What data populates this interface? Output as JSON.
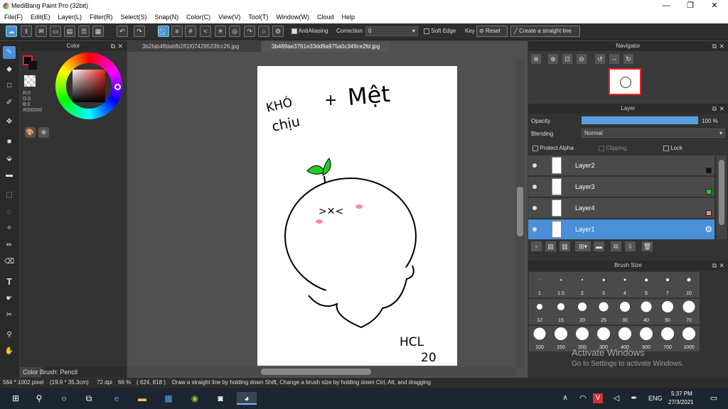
{
  "titlebar": {
    "title": "MediBang Paint Pro (32bit)",
    "minimize": "—",
    "maximize": "❐",
    "close": "✕"
  },
  "menu": [
    "File(F)",
    "Edit(E)",
    "Layer(L)",
    "Filter(R)",
    "Select(S)",
    "Snap(N)",
    "Color(C)",
    "View(V)",
    "Tool(T)",
    "Window(W)",
    "Cloud",
    "Help"
  ],
  "toolbar": {
    "antialiasing": "AntiAliasing",
    "correction_label": "Correction",
    "correction_value": "0",
    "soft_edge": "Soft Edge",
    "key": "Key",
    "reset": "Reset",
    "straight_line": "Create a straight line"
  },
  "color_panel": {
    "title": "Color",
    "r": "R:0",
    "g": "G:0",
    "b": "B:0",
    "hex": "#000000",
    "tab_color": "Color",
    "tab_brush": "Brush: Pencil"
  },
  "tabs": [
    "3b2fab4ffdabfb2ff1f07429523fcc26.jpg",
    "3b469ae3761e33dd9a975a0c349ce2fd.jpg"
  ],
  "drawing": {
    "text1": "KHÓ",
    "text2": "chịu",
    "plus": "+",
    "text3": "Mệt",
    "face": ">✕<",
    "sign1": "HCL",
    "sign2": "20"
  },
  "navigator": {
    "title": "Navigator"
  },
  "layer_panel": {
    "title": "Layer",
    "opacity_label": "Opacity",
    "opacity_value": "100 %",
    "opacity": 1.0,
    "blending_label": "Blending",
    "blending_value": "Normal",
    "protect_alpha": "Protect Alpha",
    "clipping": "Clipping",
    "lock": "Lock",
    "layers": [
      {
        "name": "Layer2",
        "color": "#111111"
      },
      {
        "name": "Layer3",
        "color": "#22cc22"
      },
      {
        "name": "Layer4",
        "color": "#ee8888"
      },
      {
        "name": "Layer1",
        "color": "#ffffff"
      }
    ]
  },
  "brush_panel": {
    "title": "Brush Size",
    "sizes": [
      "1",
      "1.5",
      "2",
      "3",
      "4",
      "5",
      "7",
      "10",
      "12",
      "15",
      "20",
      "25",
      "30",
      "40",
      "50",
      "70",
      "100",
      "150",
      "200",
      "300",
      "400",
      "500",
      "700",
      "1000"
    ]
  },
  "watermark": {
    "line1": "Activate Windows",
    "line2": "Go to Settings to activate Windows."
  },
  "status": {
    "size": "564 * 1002 pixel",
    "cm": "(19.9 * 35.3cm)",
    "dpi": "72 dpi",
    "zoom": "66 %",
    "coord": "( 624, 818 )",
    "hint": "Draw a straight line by holding down Shift, Change a brush size by holding down Ctrl, Alt, and dragging"
  },
  "taskbar": {
    "lang": "ENG",
    "time": "5:37 PM",
    "date": "27/3/2021"
  },
  "colors": {
    "accent": "#4a90d8",
    "sprout": "#22cc22",
    "blush": "#ff8a9a"
  }
}
